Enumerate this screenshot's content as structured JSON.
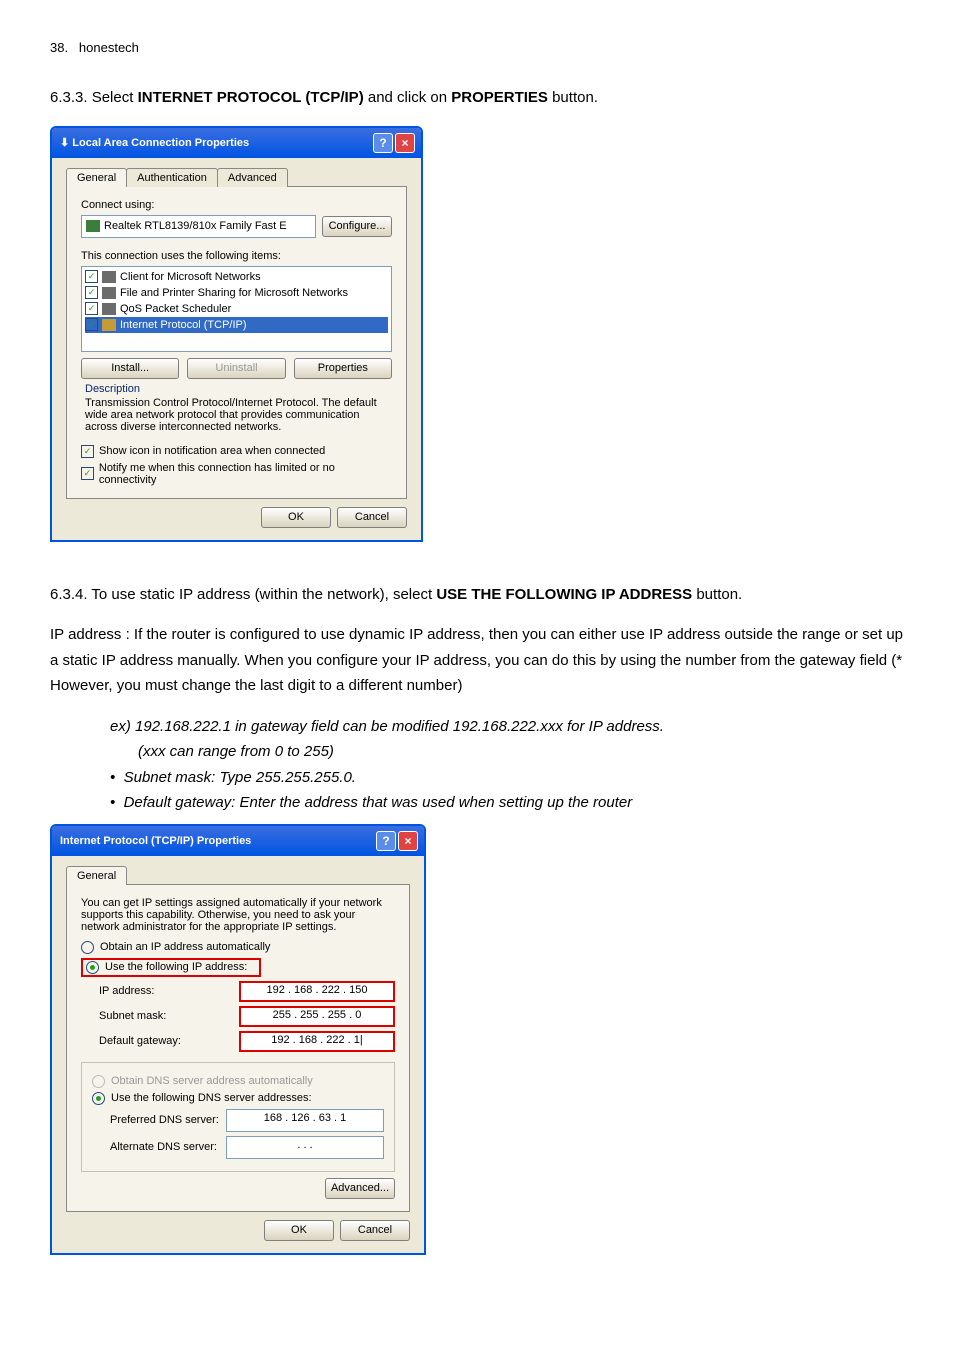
{
  "page": {
    "header_number": "38.",
    "header_text": "honestech"
  },
  "section1": {
    "prefix": "6.3.3. Select ",
    "bold1": "INTERNET PROTOCOL (TCP/IP)",
    "mid": " and click on ",
    "bold2": "PROPERTIES",
    "suffix": " button."
  },
  "dialog1": {
    "title": "Local Area Connection Properties",
    "tabs": {
      "general": "General",
      "auth": "Authentication",
      "adv": "Advanced"
    },
    "connect_using": "Connect using:",
    "adapter": "Realtek RTL8139/810x Family Fast E",
    "configure": "Configure...",
    "items_label": "This connection uses the following items:",
    "items": [
      "Client for Microsoft Networks",
      "File and Printer Sharing for Microsoft Networks",
      "QoS Packet Scheduler",
      "Internet Protocol (TCP/IP)"
    ],
    "install": "Install...",
    "uninstall": "Uninstall",
    "properties": "Properties",
    "desc_label": "Description",
    "desc_text": "Transmission Control Protocol/Internet Protocol. The default wide area network protocol that provides communication across diverse interconnected networks.",
    "show_icon": "Show icon in notification area when connected",
    "notify": "Notify me when this connection has limited or no connectivity",
    "ok": "OK",
    "cancel": "Cancel"
  },
  "section2": {
    "p1_prefix": "6.3.4. To use static IP address (within the network), select ",
    "p1_bold": "USE THE FOLLOWING IP ADDRESS",
    "p1_suffix": " button.",
    "p2": "IP address : If the router is configured to use dynamic IP address, then you can either use IP address outside the range or set up a static IP address manually. When you configure your IP address, you can do this by using the number from the gateway field (* However, you must change the last digit to a different number)",
    "ex1": "ex) 192.168.222.1 in gateway field can be modified 192.168.222.xxx for IP address.",
    "ex1b": "(xxx can range from 0 to 255)",
    "ex2": "Subnet mask: Type 255.255.255.0.",
    "ex3": "Default gateway: Enter the address that was used when setting up the router"
  },
  "dialog2": {
    "title": "Internet Protocol (TCP/IP) Properties",
    "tab": "General",
    "intro": "You can get IP settings assigned automatically if your network supports this capability. Otherwise, you need to ask your network administrator for the appropriate IP settings.",
    "obtain": "Obtain an IP address automatically",
    "use_following": "Use the following IP address:",
    "ip_label": "IP address:",
    "ip_val": "192 . 168 . 222 . 150",
    "subnet_label": "Subnet mask:",
    "subnet_val": "255 . 255 . 255 .  0",
    "gateway_label": "Default gateway:",
    "gateway_val": "192 . 168 . 222 .  1|",
    "obtain_dns": "Obtain DNS server address automatically",
    "use_dns": "Use the following DNS server addresses:",
    "pref_dns_label": "Preferred DNS server:",
    "pref_dns_val": "168 . 126 . 63 .  1",
    "alt_dns_label": "Alternate DNS server:",
    "alt_dns_val": ".         .         .",
    "advanced": "Advanced...",
    "ok": "OK",
    "cancel": "Cancel"
  }
}
